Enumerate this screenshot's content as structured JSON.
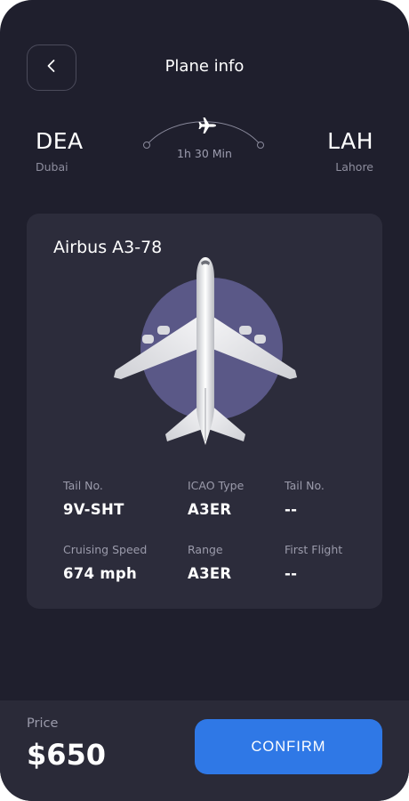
{
  "header": {
    "title": "Plane info",
    "back_icon": "chevron-left-icon"
  },
  "route": {
    "from": {
      "code": "DEA",
      "city": "Dubai"
    },
    "to": {
      "code": "LAH",
      "city": "Lahore"
    },
    "duration": "1h 30 Min",
    "plane_icon": "plane-icon"
  },
  "plane": {
    "model": "Airbus A3-78",
    "specs": [
      {
        "label": "Tail No.",
        "value": "9V-SHT"
      },
      {
        "label": "ICAO Type",
        "value": "A3ER"
      },
      {
        "label": "Tail No.",
        "value": "--"
      },
      {
        "label": "Cruising Speed",
        "value": "674 mph"
      },
      {
        "label": "Range",
        "value": "A3ER"
      },
      {
        "label": "First Flight",
        "value": "--"
      }
    ]
  },
  "footer": {
    "price_label": "Price",
    "price_value": "$650",
    "confirm_label": "CONFIRM"
  },
  "colors": {
    "background": "#1f1f2d",
    "card": "#2c2c3b",
    "accent": "#2f78e6",
    "circle": "#5a5887"
  }
}
